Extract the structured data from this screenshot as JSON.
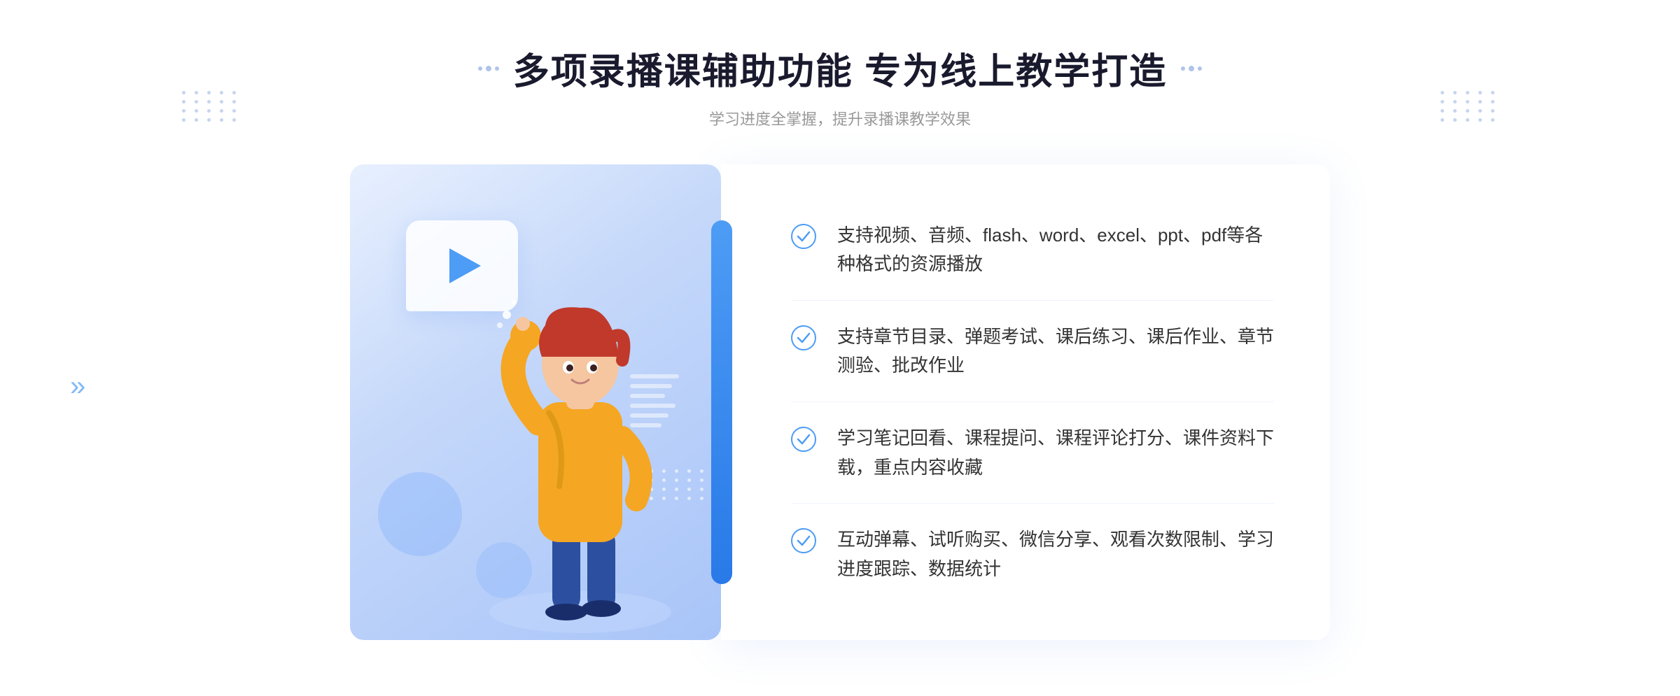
{
  "header": {
    "main_title": "多项录播课辅助功能 专为线上教学打造",
    "sub_title": "学习进度全掌握，提升录播课教学效果"
  },
  "features": [
    {
      "id": 1,
      "text": "支持视频、音频、flash、word、excel、ppt、pdf等各种格式的资源播放"
    },
    {
      "id": 2,
      "text": "支持章节目录、弹题考试、课后练习、课后作业、章节测验、批改作业"
    },
    {
      "id": 3,
      "text": "学习笔记回看、课程提问、课程评论打分、课件资料下载，重点内容收藏"
    },
    {
      "id": 4,
      "text": "互动弹幕、试听购买、微信分享、观看次数限制、学习进度跟踪、数据统计"
    }
  ],
  "colors": {
    "accent_blue": "#4d9cf5",
    "dark_blue": "#2979e8",
    "light_bg": "#e8f0fe",
    "text_dark": "#1a1a2e",
    "text_muted": "#999999",
    "text_body": "#333333"
  }
}
